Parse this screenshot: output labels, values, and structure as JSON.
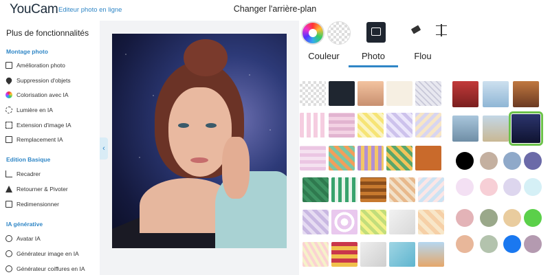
{
  "header": {
    "logo": "YouCam",
    "logo_tagline": "Editeur photo en ligne",
    "title": "Changer l'arrière-plan"
  },
  "sidebar": {
    "title": "Plus de fonctionnalités",
    "sections": [
      {
        "label": "Montage photo",
        "items": [
          {
            "label": "Amélioration photo",
            "icon": "photo-enhance-icon"
          },
          {
            "label": "Suppression d'objets",
            "icon": "eraser-icon"
          },
          {
            "label": "Colorisation avec IA",
            "icon": "color-wheel-icon"
          },
          {
            "label": "Lumière en IA",
            "icon": "light-icon"
          },
          {
            "label": "Extension d'image IA",
            "icon": "expand-icon"
          },
          {
            "label": "Remplacement IA",
            "icon": "replace-icon"
          }
        ]
      },
      {
        "label": "Edition Basique",
        "items": [
          {
            "label": "Recadrer",
            "icon": "crop-icon"
          },
          {
            "label": "Retourner & Pivoter",
            "icon": "flip-icon"
          },
          {
            "label": "Redimensionner",
            "icon": "resize-icon"
          }
        ]
      },
      {
        "label": "IA générative",
        "items": [
          {
            "label": "Avatar IA",
            "icon": "avatar-icon"
          },
          {
            "label": "Générateur image en IA",
            "icon": "image-generator-icon"
          },
          {
            "label": "Générateur coiffures en IA",
            "icon": "hairstyle-icon"
          }
        ]
      }
    ]
  },
  "panel": {
    "tabs": [
      "Couleur",
      "Photo",
      "Flou"
    ],
    "active_tab": "Photo",
    "colors": {
      "accent": "#2f86c6",
      "selected_outline": "#6cc24a"
    },
    "swatches": [
      "#000000",
      "#c4b0a0",
      "#8fa9c9",
      "#6b6aa8",
      "#f3e0f3",
      "#f7cfd6",
      "#ddd6ee",
      "#d5f0f6",
      "#e3b3b7",
      "#9aa88a",
      "#e9cc9e",
      "#5bd04a",
      "#e8b79a",
      "#b3c3ad",
      "#1a78f0",
      "#b49ab0"
    ]
  }
}
